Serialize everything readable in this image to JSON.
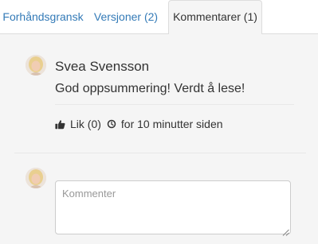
{
  "tabs": [
    {
      "label": "Forhåndsgransk",
      "active": false
    },
    {
      "label": "Versjoner (2)",
      "active": false
    },
    {
      "label": "Kommentarer (1)",
      "active": true
    }
  ],
  "comment": {
    "author": "Svea Svensson",
    "text": "God oppsummering! Verdt å lese!",
    "like_label": "Lik (0)",
    "time": "for 10 minutter siden"
  },
  "new_comment": {
    "placeholder": "Kommenter"
  },
  "colors": {
    "link": "#337ab7",
    "panel_background": "#f5f5f5",
    "text": "#333333"
  },
  "icons": {
    "like": "thumbs-up-icon",
    "time": "clock-icon",
    "resize": "resize-grip-icon"
  }
}
